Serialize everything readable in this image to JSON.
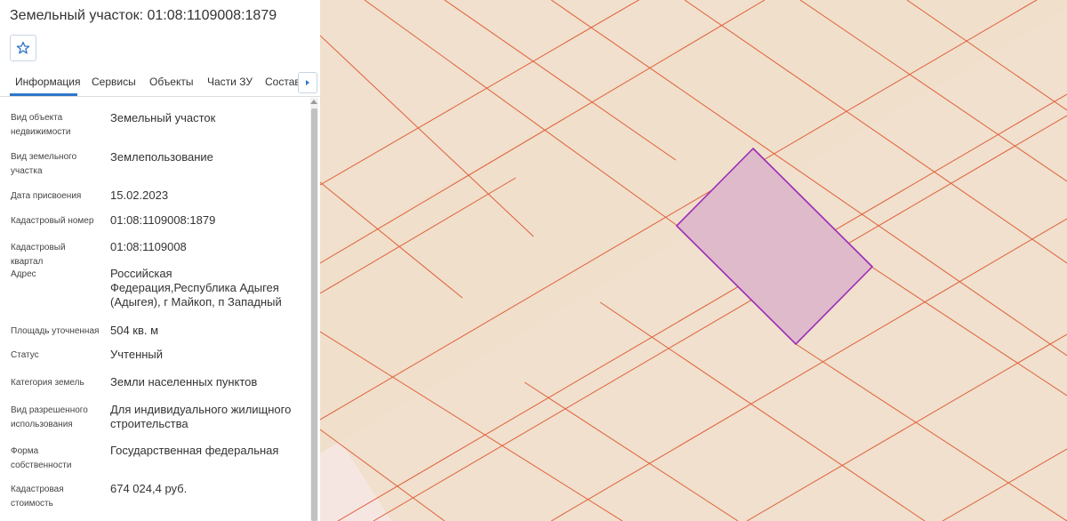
{
  "panel": {
    "title": "Земельный участок: 01:08:1109008:1879",
    "favorite_icon": "star-outline-icon",
    "tabs": [
      "Информация",
      "Сервисы",
      "Объекты",
      "Части ЗУ",
      "Состав"
    ],
    "active_tab": "Информация",
    "tabs_next_icon": "caret-right-icon",
    "info": [
      {
        "label": "Вид объекта недвижимости",
        "value": "Земельный участок"
      },
      {
        "label": "Вид земельного участка",
        "value": "Землепользование"
      },
      {
        "label": "Дата присвоения",
        "value": "15.02.2023"
      },
      {
        "label": "Кадастровый номер",
        "value": "01:08:1109008:1879"
      },
      {
        "label": "Кадастровый квартал",
        "value": "01:08:1109008"
      },
      {
        "label": "Адрес",
        "value": "Российская Федерация,Республика Адыгея (Адыгея), г Майкоп, п Западный"
      },
      {
        "label": "Площадь уточненная",
        "value": "504 кв. м"
      },
      {
        "label": "Статус",
        "value": "Учтенный"
      },
      {
        "label": "Категория земель",
        "value": "Земли населенных пунктов"
      },
      {
        "label": "Вид разрешенного использования",
        "value": "Для индивидуального жилищного строительства"
      },
      {
        "label": "Форма собственности",
        "value": "Государственная федеральная"
      },
      {
        "label": "Кадастровая стоимость",
        "value": "674 024,4 руб."
      }
    ]
  },
  "colors": {
    "accent": "#2f76c9",
    "map_background": "#f0e0cd",
    "parcel_boundary": "#e0603a",
    "selected_fill": "#dfbacb",
    "selected_stroke": "#9b2bb5",
    "corner_area": "#f5e6e2"
  }
}
